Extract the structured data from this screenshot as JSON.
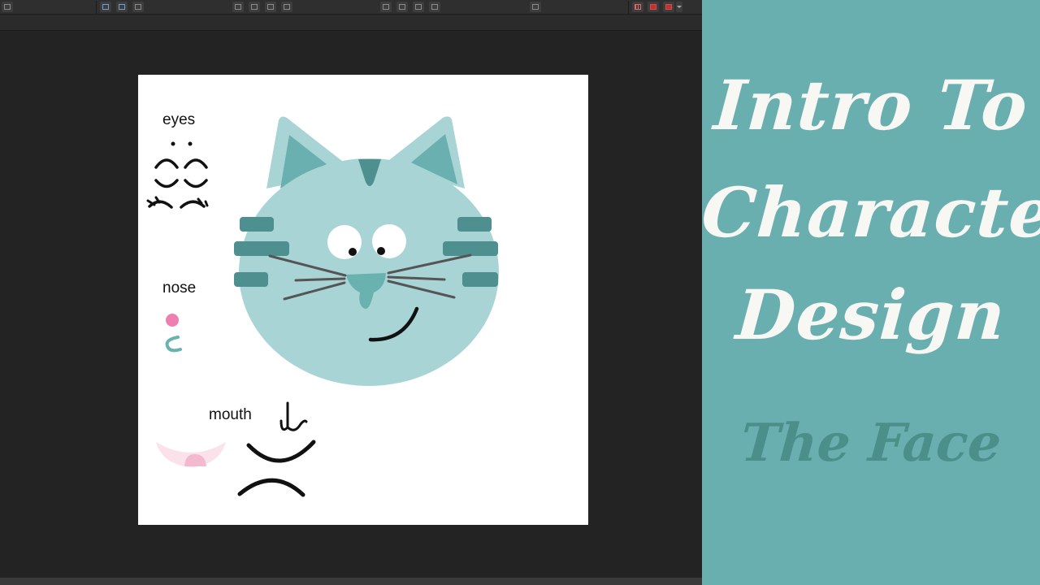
{
  "canvas": {
    "labels": {
      "eyes": "eyes",
      "nose": "nose",
      "mouth": "mouth"
    }
  },
  "title_panel": {
    "line1": "Intro To",
    "line2": "Character",
    "line3": "Design",
    "subtitle": "The Face"
  },
  "colors": {
    "panel_bg": "#6aafaf",
    "title_text": "#f7f7f3",
    "subtitle_text": "#4a8f8a",
    "cat_face": "#a9d4d6",
    "cat_stripes": "#4e8f8f",
    "cat_ear_inner": "#6ab0b0",
    "nose": "#6ab2b0",
    "whiskers": "#555555",
    "pink_nose": "#ee7fb1",
    "mouth_pink": "#fbe1ea"
  },
  "toolbar": {
    "icons": [
      "app-menu-icon",
      "select-icon",
      "transform-icon",
      "crop-icon",
      "arrange-icon",
      "group-icon",
      "ungroup-icon",
      "layer-icon",
      "align-left-icon",
      "align-center-icon",
      "align-right-icon",
      "distribute-icon",
      "text-align-icon",
      "grid-icon",
      "snap-icon",
      "magnet-icon",
      "dropdown-icon"
    ]
  }
}
